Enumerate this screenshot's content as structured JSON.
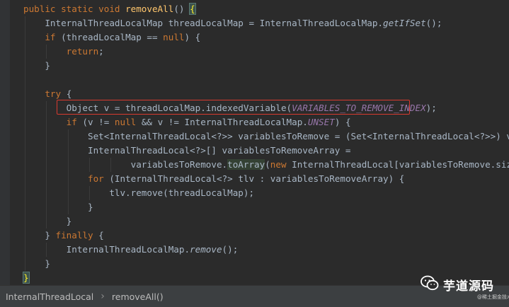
{
  "editor": {
    "lines": [
      [
        {
          "t": "public static void ",
          "c": "kw"
        },
        {
          "t": "removeAll",
          "c": "fn"
        },
        {
          "t": "() "
        },
        {
          "t": "{",
          "c": "brace-hl"
        }
      ],
      [
        {
          "t": "    InternalThreadLocalMap threadLocalMap = InternalThreadLocalMap."
        },
        {
          "t": "getIfSet",
          "c": "it"
        },
        {
          "t": "();"
        }
      ],
      [
        {
          "t": "    "
        },
        {
          "t": "if ",
          "c": "kw"
        },
        {
          "t": "(threadLocalMap == "
        },
        {
          "t": "null",
          "c": "kw"
        },
        {
          "t": ") {"
        }
      ],
      [
        {
          "t": "        "
        },
        {
          "t": "return",
          "c": "kw"
        },
        {
          "t": ";"
        }
      ],
      [
        {
          "t": "    }"
        }
      ],
      [
        {
          "t": ""
        }
      ],
      [
        {
          "t": "    "
        },
        {
          "t": "try ",
          "c": "kw"
        },
        {
          "t": "{"
        }
      ],
      [
        {
          "t": "        Object v = threadLocalMap.indexedVariable("
        },
        {
          "t": "VARIABLES_TO_REMOVE_INDEX",
          "c": "const"
        },
        {
          "t": ");"
        }
      ],
      [
        {
          "t": "        "
        },
        {
          "t": "if ",
          "c": "kw"
        },
        {
          "t": "(v != "
        },
        {
          "t": "null ",
          "c": "kw"
        },
        {
          "t": "&& v != InternalThreadLocalMap."
        },
        {
          "t": "UNSET",
          "c": "const"
        },
        {
          "t": ") {"
        }
      ],
      [
        {
          "t": "            Set<InternalThreadLocal<?>> variablesToRemove = (Set<InternalThreadLocal<?>>) v;"
        }
      ],
      [
        {
          "t": "            InternalThreadLocal<?>[] variablesToRemoveArray ="
        }
      ],
      [
        {
          "t": "                    variablesToRemove."
        },
        {
          "t": "toArray",
          "c": "usage-hl"
        },
        {
          "t": "("
        },
        {
          "t": "new ",
          "c": "kw"
        },
        {
          "t": "InternalThreadLocal[variablesToRemove.size()]);"
        }
      ],
      [
        {
          "t": "            "
        },
        {
          "t": "for ",
          "c": "kw"
        },
        {
          "t": "(InternalThreadLocal<?> tlv : variablesToRemoveArray) {"
        }
      ],
      [
        {
          "t": "                tlv.remove(threadLocalMap);"
        }
      ],
      [
        {
          "t": "            }"
        }
      ],
      [
        {
          "t": "        }"
        }
      ],
      [
        {
          "t": "    } "
        },
        {
          "t": "finally ",
          "c": "kw"
        },
        {
          "t": "{"
        }
      ],
      [
        {
          "t": "        InternalThreadLocalMap."
        },
        {
          "t": "remove",
          "c": "it"
        },
        {
          "t": "();"
        }
      ],
      [
        {
          "t": "    }"
        }
      ],
      [
        {
          "t": "}",
          "c": "brace-hl"
        }
      ]
    ]
  },
  "statusbar": {
    "breadcrumb": [
      "InternalThreadLocal",
      "removeAll()"
    ],
    "separator": "›"
  },
  "watermark": {
    "title": "芋道源码",
    "subtitle": "@稀土掘金技术社区"
  },
  "colors": {
    "background": "#2b2b2b",
    "keyword": "#cc7832",
    "method_declaration": "#ffc66d",
    "constant": "#9876aa",
    "default_text": "#a9b7c6",
    "highlight_box": "#d73a2f"
  }
}
